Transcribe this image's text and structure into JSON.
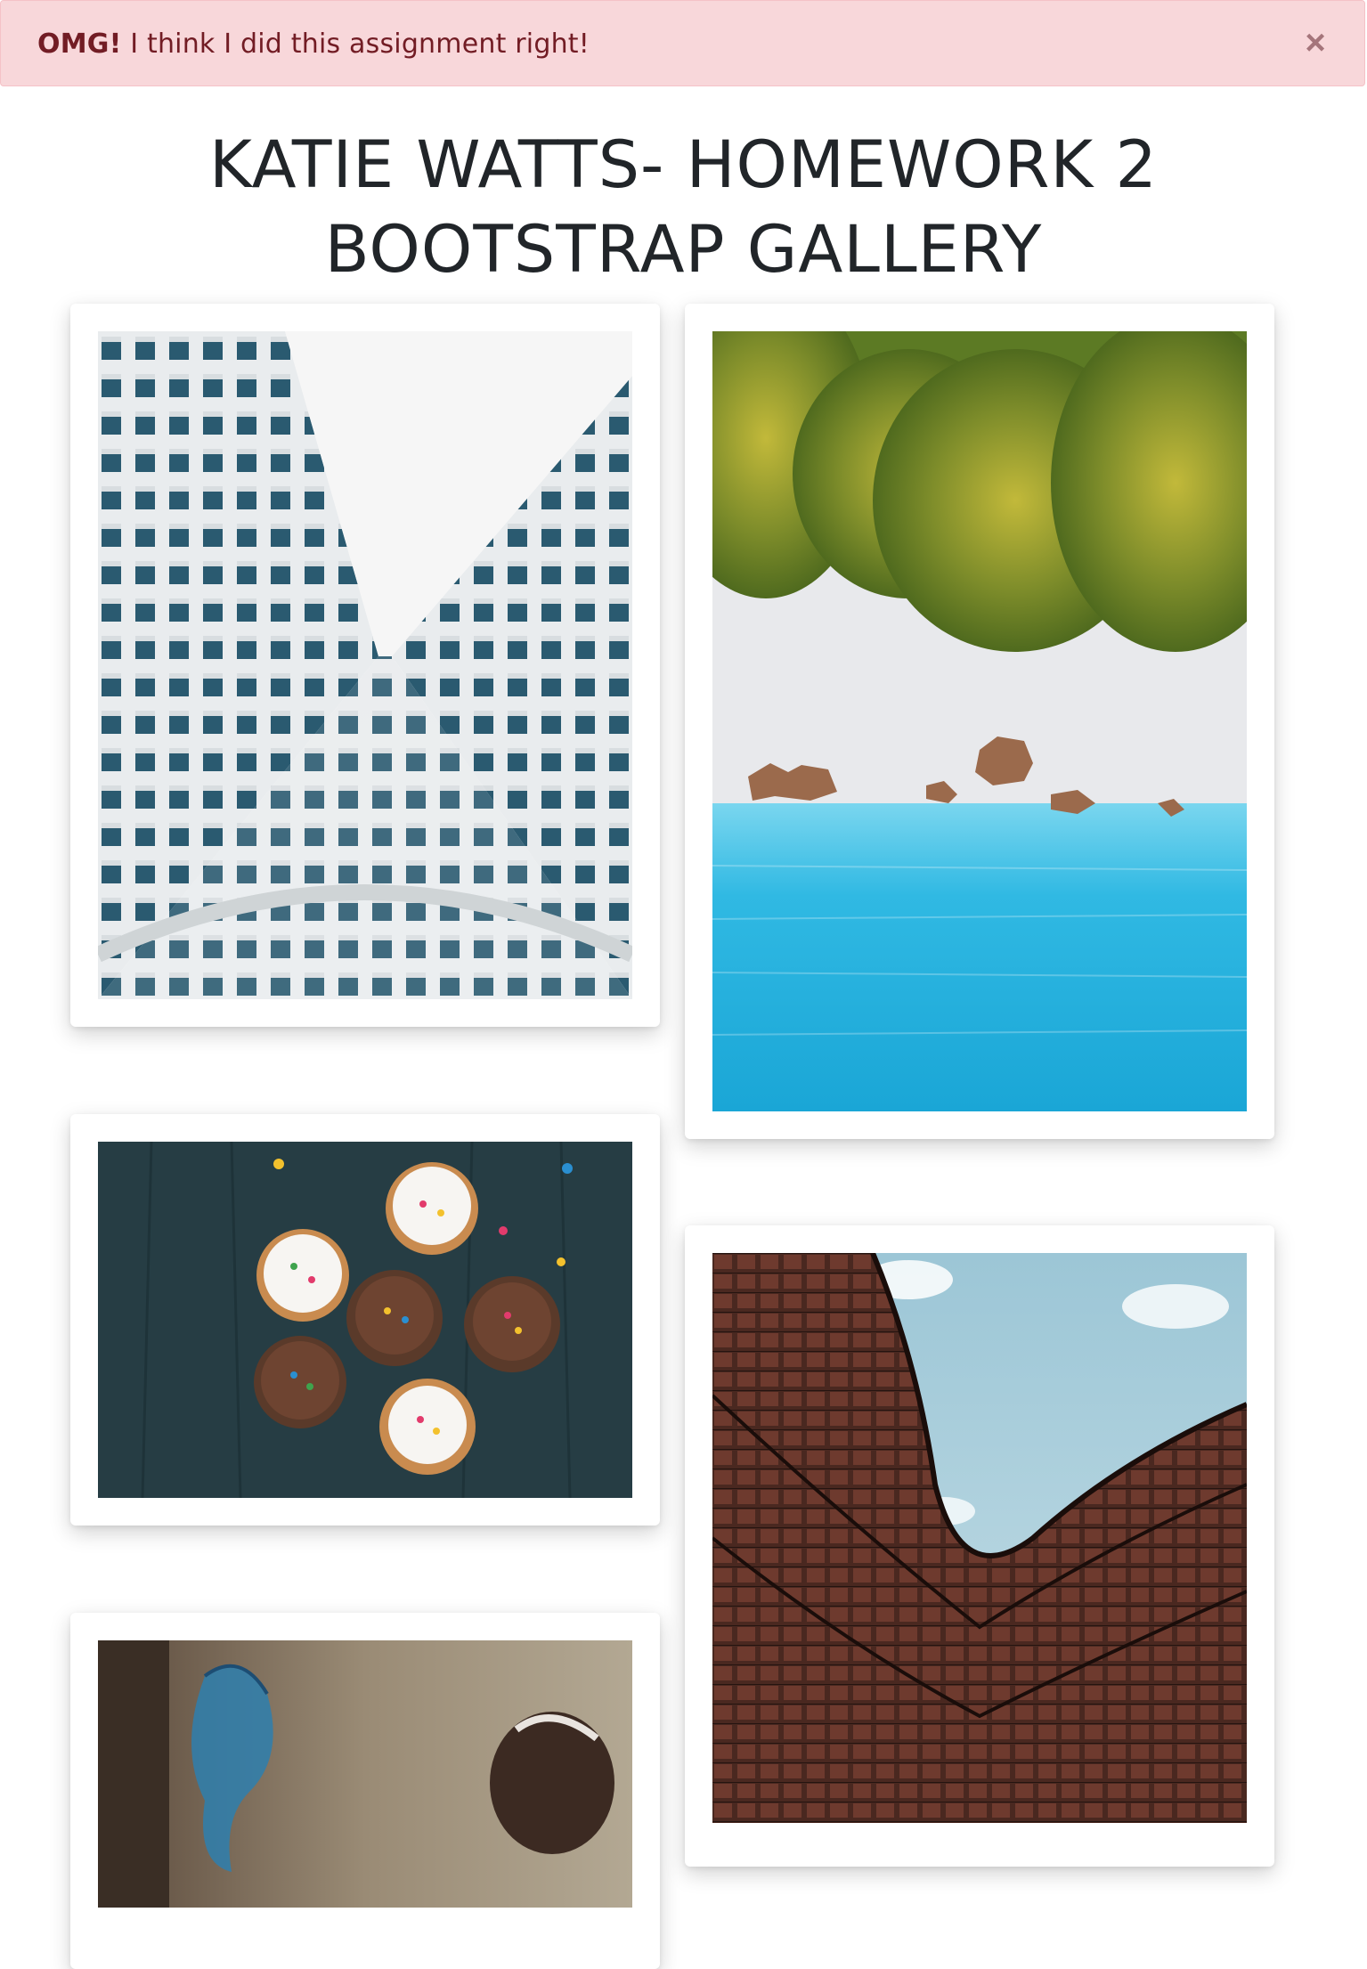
{
  "alert": {
    "strong": "OMG!",
    "message": " I think I did this assignment right!",
    "close_glyph": "×"
  },
  "header": {
    "title_line1": "KATIE WATTS- HOMEWORK 2",
    "title_line2": "BOOTSTRAP GALLERY"
  },
  "gallery": {
    "photos": [
      {
        "subject": "looking up between white apartment buildings"
      },
      {
        "subject": "aerial view of palm trees, beach and turquoise sea"
      },
      {
        "subject": "cupcakes with sprinkles on dark wooden table"
      },
      {
        "subject": "curved building with red grid facade against sky"
      },
      {
        "subject": "graffiti wall with figure"
      }
    ]
  },
  "colors": {
    "alert_bg": "#f8d7da",
    "alert_text": "#721c24",
    "title": "#212529"
  }
}
